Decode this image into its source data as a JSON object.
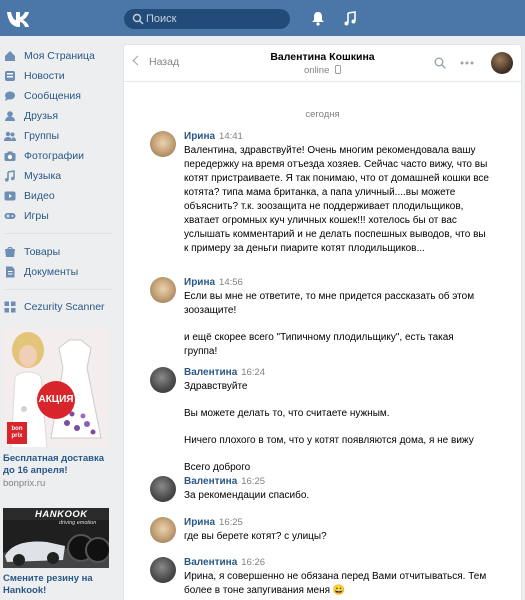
{
  "topbar": {
    "logo": "vk-logo",
    "search_placeholder": "Поиск",
    "icons": [
      "bell-icon",
      "music-note-icon"
    ]
  },
  "sidebar": {
    "items": [
      {
        "label": "Моя Страница",
        "icon": "home-icon"
      },
      {
        "label": "Новости",
        "icon": "news-icon"
      },
      {
        "label": "Сообщения",
        "icon": "chat-icon"
      },
      {
        "label": "Друзья",
        "icon": "user-icon"
      },
      {
        "label": "Группы",
        "icon": "users-icon"
      },
      {
        "label": "Фотографии",
        "icon": "camera-icon"
      },
      {
        "label": "Музыка",
        "icon": "music-icon"
      },
      {
        "label": "Видео",
        "icon": "video-icon"
      },
      {
        "label": "Игры",
        "icon": "gamepad-icon"
      },
      {
        "label": "Товары",
        "icon": "shop-icon"
      },
      {
        "label": "Документы",
        "icon": "document-icon"
      },
      {
        "label": "Cezurity Scanner",
        "icon": "app-icon"
      }
    ]
  },
  "ads": [
    {
      "badge": "АКЦИЯ",
      "brand": "bon prix",
      "title": "Бесплатная доставка до 16 апреля!",
      "url": "bonprix.ru"
    },
    {
      "brand": "HANKOOK",
      "tagline": "driving emotion",
      "title": "Смените резину на Hankook!"
    }
  ],
  "chat": {
    "back_label": "Назад",
    "contact_name": "Валентина Кошкина",
    "contact_status": "online",
    "date_divider": "сегодня",
    "messages": [
      {
        "author": "Ирина",
        "time": "14:41",
        "paragraphs": [
          "Валентина, здравствуйте! Очень многим рекомендовала вашу передержку на время отъезда хозяев. Сейчас часто вижу, что вы котят пристраиваете. Я так понимаю, что от домашней кошки все котята? типа мама британка, а папа уличный....вы можете объяснить? т.к. зоозащита не поддерживает плодильщиков, хватает огромных куч уличных кошек!!! хотелось бы от вас услышать комментарий и не делать поспешных выводов, что вы к примеру за деньги пиарите котят плодильщиков..."
        ]
      },
      {
        "author": "Ирина",
        "time": "14:56",
        "paragraphs": [
          "Если вы мне не ответите, то мне придется рассказать об этом зоозащите!",
          "и ещё скорее всего \"Типичному плодильщику\", есть такая группа!"
        ]
      },
      {
        "author": "Валентина",
        "time": "16:24",
        "paragraphs": [
          "Здравствуйте",
          "Вы можете делать то, что считаете нужным.",
          "Ничего плохого в том, что у котят появляются дома, я не вижу",
          "Всего доброго"
        ]
      },
      {
        "author": "Валентина",
        "time": "16:25",
        "paragraphs": [
          "За рекомендации спасибо."
        ]
      },
      {
        "author": "Ирина",
        "time": "16:25",
        "paragraphs": [
          "где вы берете котят? с улицы?"
        ]
      },
      {
        "author": "Валентина",
        "time": "16:26",
        "paragraphs": [
          "Ирина, я совершенно не обязана перед Вами отчитываться. Тем более в тоне запугивания меня 😀"
        ]
      }
    ]
  },
  "colors": {
    "topbar": "#4a76a8",
    "link": "#2a5885",
    "muted": "#828282",
    "background": "#edeef0"
  }
}
